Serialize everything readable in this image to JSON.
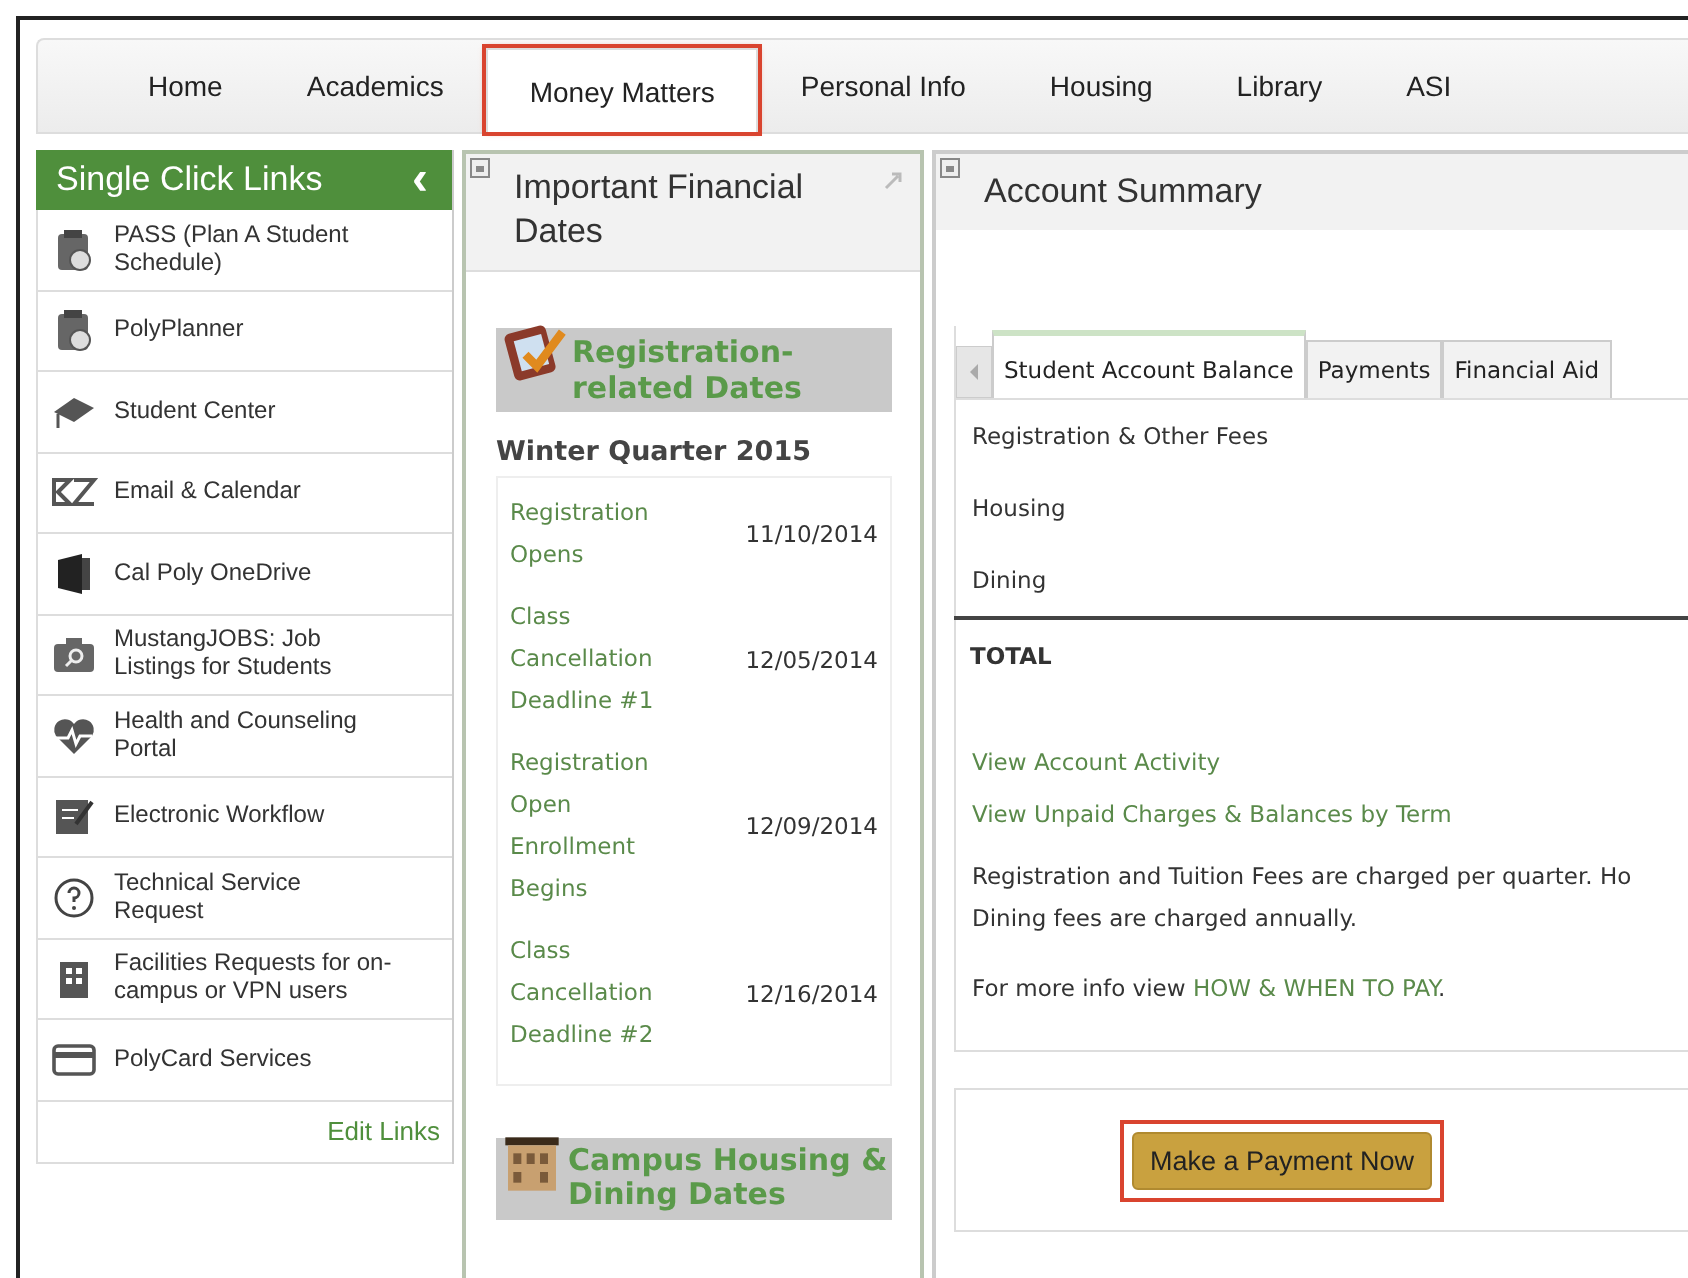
{
  "nav": {
    "tabs": [
      {
        "label": "Home",
        "selected": false,
        "highlighted": false
      },
      {
        "label": "Academics",
        "selected": false,
        "highlighted": false
      },
      {
        "label": "Money Matters",
        "selected": true,
        "highlighted": true
      },
      {
        "label": "Personal Info",
        "selected": false,
        "highlighted": false
      },
      {
        "label": "Housing",
        "selected": false,
        "highlighted": false
      },
      {
        "label": "Library",
        "selected": false,
        "highlighted": false
      },
      {
        "label": "ASI",
        "selected": false,
        "highlighted": false
      }
    ]
  },
  "sidebar": {
    "title": "Single Click Links",
    "collapse": "‹",
    "items": [
      {
        "label": "PASS (Plan A Student Schedule)"
      },
      {
        "label": "PolyPlanner"
      },
      {
        "label": "Student Center"
      },
      {
        "label": "Email & Calendar"
      },
      {
        "label": "Cal Poly OneDrive"
      },
      {
        "label": "MustangJOBS: Job Listings for Students"
      },
      {
        "label": "Health and Counseling Portal"
      },
      {
        "label": "Electronic Workflow"
      },
      {
        "label": "Technical Service Request"
      },
      {
        "label": "Facilities Requests for on-campus or VPN users"
      },
      {
        "label": "PolyCard Services"
      }
    ],
    "edit_link": "Edit Links"
  },
  "dates_panel": {
    "title": "Important Financial Dates",
    "section": "Registration-related Dates",
    "term": "Winter Quarter 2015",
    "rows": [
      {
        "event": "Registration Opens",
        "date": "11/10/2014"
      },
      {
        "event": "Class Cancellation Deadline #1",
        "date": "12/05/2014"
      },
      {
        "event": "Registration Open Enrollment Begins",
        "date": "12/09/2014"
      },
      {
        "event": "Class Cancellation Deadline #2",
        "date": "12/16/2014"
      }
    ],
    "next_section": "Campus Housing & Dining Dates"
  },
  "account_panel": {
    "title": "Account Summary",
    "tabs": [
      {
        "label": "Student Account Balance",
        "selected": true
      },
      {
        "label": "Payments",
        "selected": false
      },
      {
        "label": "Financial Aid",
        "selected": false
      }
    ],
    "rows": [
      "Registration & Other Fees",
      "Housing",
      "Dining"
    ],
    "total": "TOTAL",
    "links": [
      "View Account Activity",
      "View Unpaid Charges & Balances by Term"
    ],
    "note": "Registration and Tuition Fees are charged per quarter. Ho",
    "note_2": "Dining fees are charged annually.",
    "info_prefix": "For more info view ",
    "info_link": "HOW & WHEN TO PAY",
    "info_suffix": ".",
    "pay_button": {
      "label": "Make a Payment Now",
      "highlighted": true
    }
  }
}
